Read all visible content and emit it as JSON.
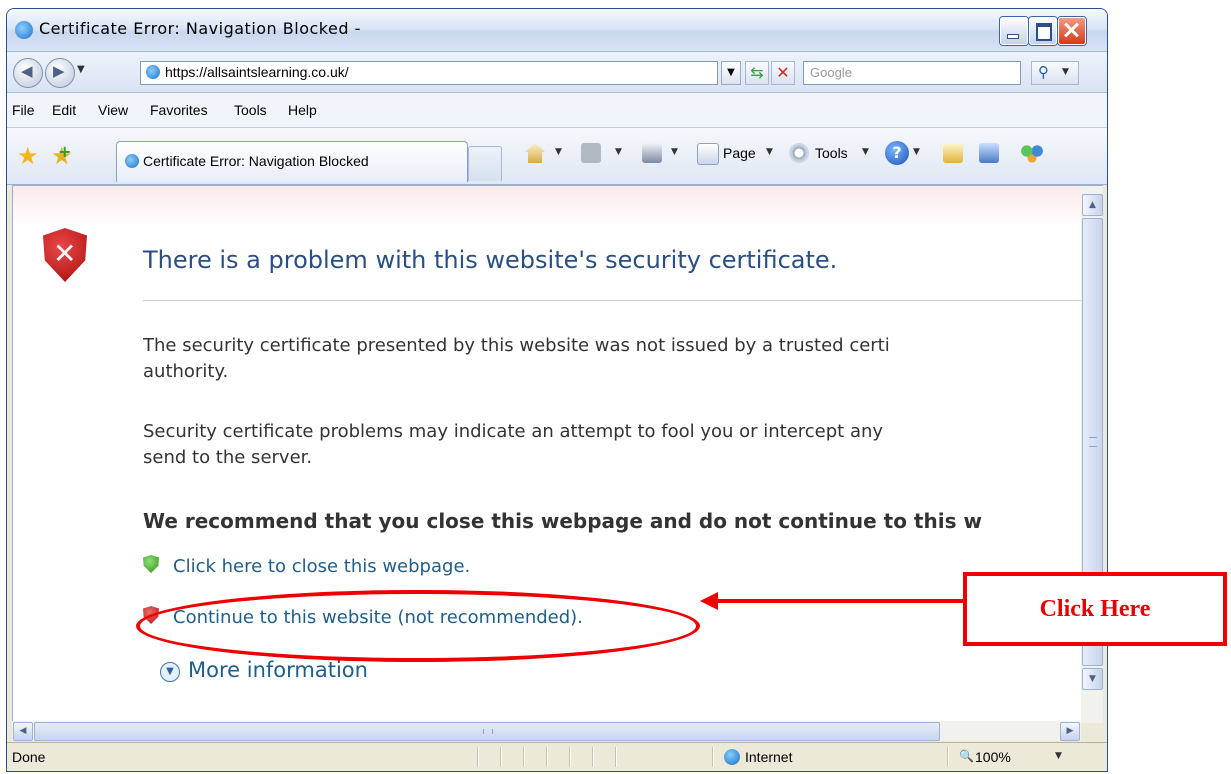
{
  "window": {
    "title": "Certificate Error: Navigation Blocked -"
  },
  "address_bar": {
    "url": "https://allsaintslearning.co.uk/",
    "search_placeholder": "Google"
  },
  "menu": [
    "File",
    "Edit",
    "View",
    "Favorites",
    "Tools",
    "Help"
  ],
  "tab": {
    "title": "Certificate Error: Navigation Blocked"
  },
  "command_bar": {
    "page_label": "Page",
    "tools_label": "Tools"
  },
  "page": {
    "headline": "There is a problem with this website's security certificate.",
    "para1_line1": "The security certificate presented by this website was not issued by a trusted certi",
    "para1_line2": "authority.",
    "para2_line1": "Security certificate problems may indicate an attempt to fool you or intercept any",
    "para2_line2": "send to the server.",
    "recommend": "We recommend that you close this webpage and do not continue to this w",
    "close_link": "Click here to close this webpage.",
    "continue_link": "Continue to this website (not recommended).",
    "more_info": "More information"
  },
  "status_bar": {
    "status": "Done",
    "zone": "Internet",
    "zoom": "100%"
  },
  "annotation": {
    "label": "Click Here",
    "color": "#ee0000"
  },
  "icons": [
    "ie-icon",
    "back-icon",
    "forward-icon",
    "refresh-icon",
    "stop-icon",
    "search-icon",
    "favorites-star-icon",
    "add-favorite-icon",
    "home-icon",
    "feeds-icon",
    "print-icon",
    "page-icon",
    "tools-gear-icon",
    "help-icon",
    "research-icon",
    "messenger-icon",
    "shield-error-icon",
    "shield-ok-icon",
    "globe-icon",
    "zoom-icon"
  ]
}
